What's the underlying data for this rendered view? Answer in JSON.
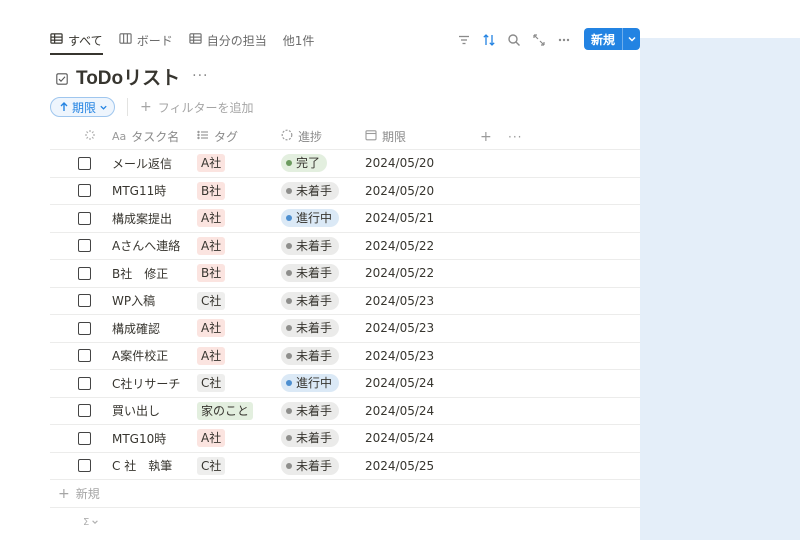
{
  "tabs": [
    {
      "label": "すべて",
      "icon": "table-icon",
      "active": true
    },
    {
      "label": "ボード",
      "icon": "board-icon",
      "active": false
    },
    {
      "label": "自分の担当",
      "icon": "table-icon",
      "active": false
    },
    {
      "label": "他1件",
      "icon": "",
      "active": false
    }
  ],
  "toolbar": {
    "icons": [
      "filter-icon",
      "sort-icon",
      "search-icon",
      "expand-icon",
      "more-icon"
    ],
    "new_label": "新規"
  },
  "page": {
    "title": "ToDoリスト",
    "title_icon": "checkbox-icon",
    "more": "···"
  },
  "filters": {
    "sort_label": "期限",
    "add_filter_label": "フィルターを追加"
  },
  "columns": [
    {
      "label": "",
      "icon": "loading-icon"
    },
    {
      "label": "タスク名",
      "icon": "text-icon",
      "prefix": "Aa"
    },
    {
      "label": "タグ",
      "icon": "list-icon"
    },
    {
      "label": "進捗",
      "icon": "status-icon"
    },
    {
      "label": "期限",
      "icon": "calendar-icon"
    }
  ],
  "header_actions": {
    "add": "+",
    "more": "···"
  },
  "colors": {
    "tag_A": "#fbe4e0",
    "tag_B": "#fbe4e0",
    "tag_C": "#eeeeed",
    "tag_home": "#e3efdf",
    "status_done_bg": "#e3efdf",
    "status_done_dot": "#6c9b5f",
    "status_todo_bg": "#ebebea",
    "status_todo_dot": "#8e8e8c",
    "status_doing_bg": "#dbe9f6",
    "status_doing_dot": "#4d8fd0",
    "accent": "#2383e2"
  },
  "rows": [
    {
      "task": "メール返信",
      "tag": "A社",
      "tag_color": "tag_A",
      "status": "完了",
      "status_kind": "done",
      "date": "2024/05/20"
    },
    {
      "task": "MTG11時",
      "tag": "B社",
      "tag_color": "tag_B",
      "status": "未着手",
      "status_kind": "todo",
      "date": "2024/05/20"
    },
    {
      "task": "構成案提出",
      "tag": "A社",
      "tag_color": "tag_A",
      "status": "進行中",
      "status_kind": "doing",
      "date": "2024/05/21"
    },
    {
      "task": "Aさんへ連絡",
      "tag": "A社",
      "tag_color": "tag_A",
      "status": "未着手",
      "status_kind": "todo",
      "date": "2024/05/22"
    },
    {
      "task": "B社　修正",
      "tag": "B社",
      "tag_color": "tag_B",
      "status": "未着手",
      "status_kind": "todo",
      "date": "2024/05/22"
    },
    {
      "task": "WP入稿",
      "tag": "C社",
      "tag_color": "tag_C",
      "status": "未着手",
      "status_kind": "todo",
      "date": "2024/05/23"
    },
    {
      "task": "構成確認",
      "tag": "A社",
      "tag_color": "tag_A",
      "status": "未着手",
      "status_kind": "todo",
      "date": "2024/05/23"
    },
    {
      "task": "A案件校正",
      "tag": "A社",
      "tag_color": "tag_A",
      "status": "未着手",
      "status_kind": "todo",
      "date": "2024/05/23"
    },
    {
      "task": "C社リサーチ",
      "tag": "C社",
      "tag_color": "tag_C",
      "status": "進行中",
      "status_kind": "doing",
      "date": "2024/05/24"
    },
    {
      "task": "買い出し",
      "tag": "家のこと",
      "tag_color": "tag_home",
      "status": "未着手",
      "status_kind": "todo",
      "date": "2024/05/24"
    },
    {
      "task": "MTG10時",
      "tag": "A社",
      "tag_color": "tag_A",
      "status": "未着手",
      "status_kind": "todo",
      "date": "2024/05/24"
    },
    {
      "task": "C 社　執筆",
      "tag": "C社",
      "tag_color": "tag_C",
      "status": "未着手",
      "status_kind": "todo",
      "date": "2024/05/25"
    }
  ],
  "footer": {
    "new_label": "新規",
    "sum_label": "Σ"
  }
}
